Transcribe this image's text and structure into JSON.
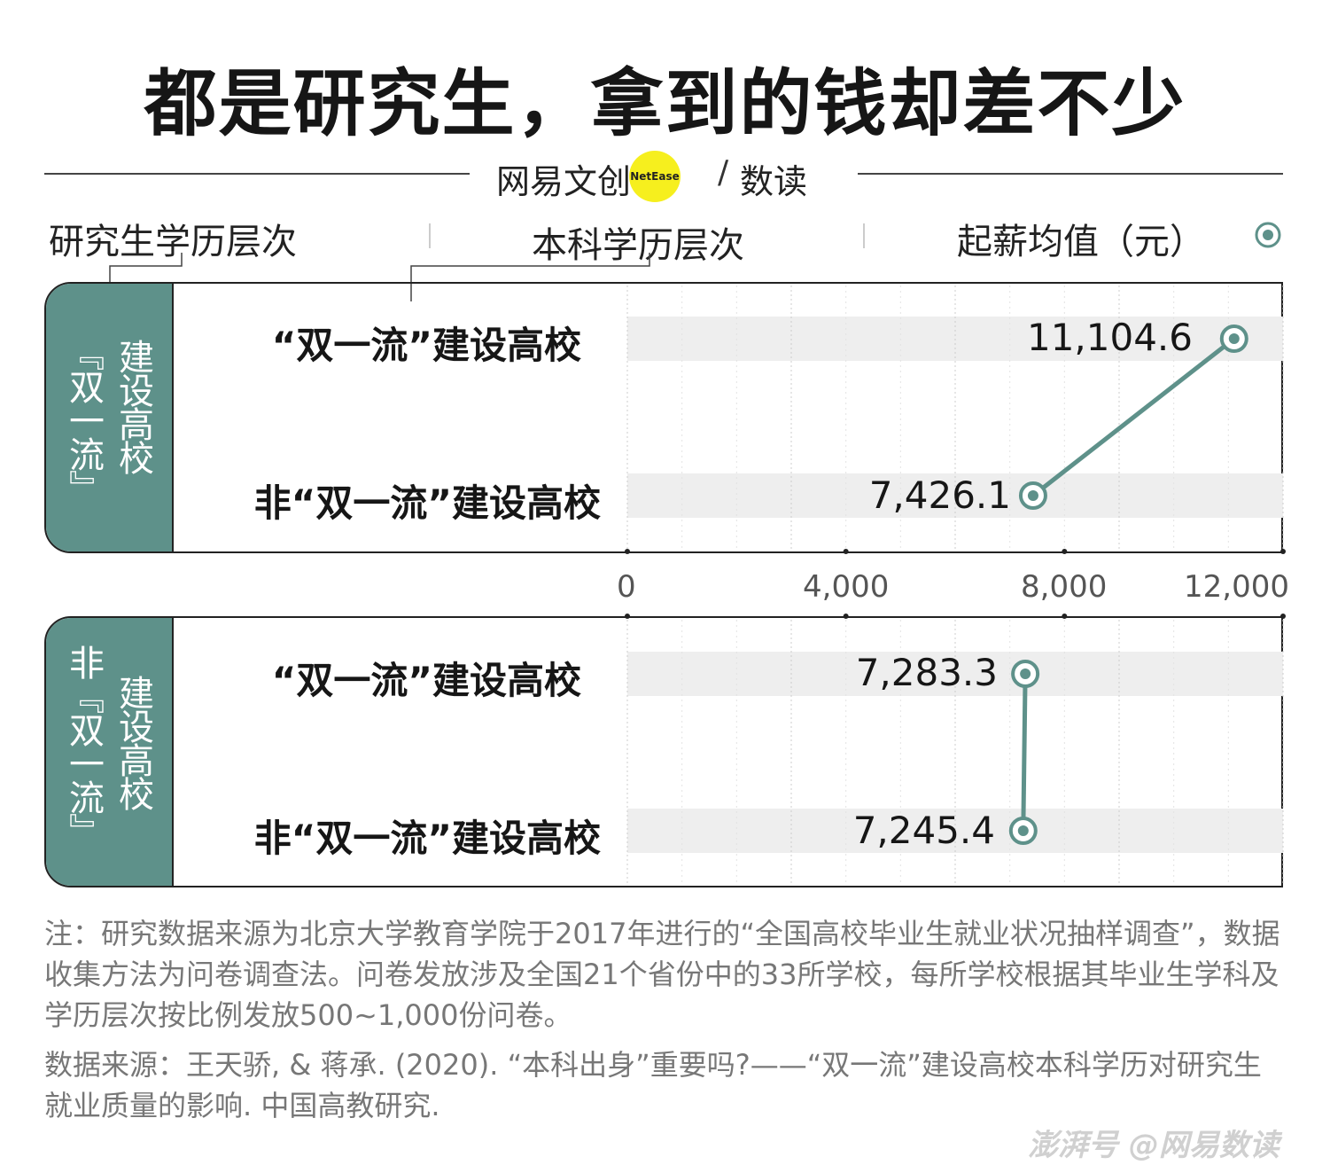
{
  "title": "都是研究生，拿到的钱却差不少",
  "logo": {
    "left_text": "网易文创",
    "badge": "NetEase",
    "slash": "/",
    "right_text": "数读"
  },
  "headers": {
    "grad_level": "研究生学历层次",
    "undergrad_level": "本科学历层次",
    "value_label": "起薪均值（元）"
  },
  "panels": [
    {
      "label_a": "『双一流』",
      "label_b": "建设高校"
    },
    {
      "label_a": "非『双一流』",
      "label_b": "建设高校"
    }
  ],
  "row_labels": {
    "dfc": "“双一流”建设高校",
    "non_dfc": "非“双一流”建设高校"
  },
  "value_labels": {
    "p1_dfc": "11,104.6",
    "p1_non": "7,426.1",
    "p2_dfc": "7,283.3",
    "p2_non": "7,245.4"
  },
  "axis_ticks": [
    "0",
    "4,000",
    "8,000",
    "12,000"
  ],
  "chart_data": {
    "type": "scatter",
    "title": "都是研究生，拿到的钱却差不少",
    "xlabel": "起薪均值（元）",
    "xlim": [
      0,
      12000
    ],
    "xticks": [
      0,
      4000,
      8000,
      12000
    ],
    "series": [
      {
        "name": "“双一流”建设高校",
        "categories": [
          "“双一流”建设高校",
          "非“双一流”建设高校"
        ],
        "values": [
          11104.6,
          7426.1
        ]
      },
      {
        "name": "非“双一流”建设高校",
        "categories": [
          "“双一流”建设高校",
          "非“双一流”建设高校"
        ],
        "values": [
          7283.3,
          7245.4
        ]
      }
    ]
  },
  "colors": {
    "accent": "#5e918a",
    "band": "#eeeeee",
    "logo_yellow": "#f6ef1e"
  },
  "note": "注：研究数据来源为北京大学教育学院于2017年进行的“全国高校毕业生就业状况抽样调查”，数据收集方法为问卷调查法。问卷发放涉及全国21个省份中的33所学校，每所学校根据其毕业生学科及学历层次按比例发放500~1,000份问卷。",
  "source": "数据来源：王天骄, & 蒋承. (2020). “本科出身”重要吗?——“双一流”建设高校本科学历对研究生就业质量的影响. 中国高教研究.",
  "watermark": "澎湃号 @网易数读"
}
